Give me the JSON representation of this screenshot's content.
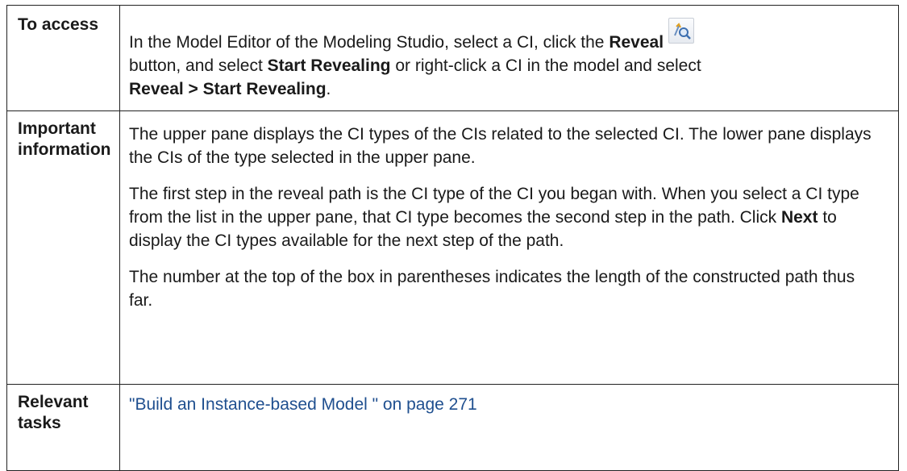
{
  "rows": [
    {
      "heading": "To access",
      "access": {
        "t1": "In the Model Editor of the Modeling Studio, select a CI, click the ",
        "b1": "Reveal",
        "icon": "reveal-search-icon",
        "t2": "button, and select ",
        "b2": "Start Revealing",
        "t3": " or right-click a CI in the model and select ",
        "b3": "Reveal > Start Revealing",
        "t4": "."
      }
    },
    {
      "heading_line1": "Important",
      "heading_line2": "information",
      "p1": "The upper pane displays the CI types of the CIs related to the selected CI. The lower pane displays the CIs of the type selected in the upper pane.",
      "p2": {
        "t1": "The first step in the reveal path is the CI type of the CI you began with. When you select a CI type from the list in the upper pane, that CI type becomes the second step in the path. Click ",
        "b1": "Next",
        "t2": " to display the CI types available for the next step of the path."
      },
      "p3": "The number at the top of the box in parentheses indicates the length of the constructed path thus far."
    },
    {
      "heading_line1": "Relevant",
      "heading_line2": "tasks",
      "link": "\"Build an Instance-based Model \" on page 271"
    }
  ],
  "colors": {
    "link": "#1f4f8f",
    "border": "#222222",
    "text": "#1a1a1a"
  }
}
